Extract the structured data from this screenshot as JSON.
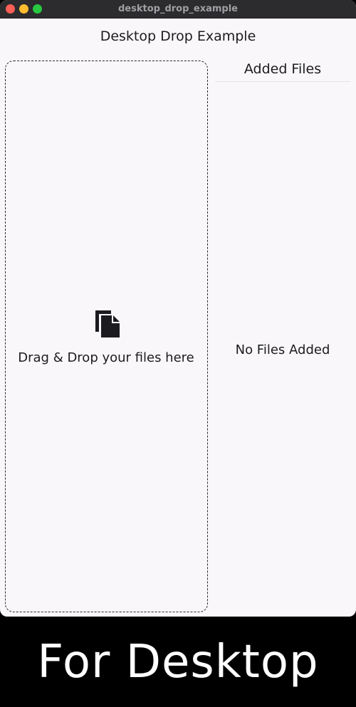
{
  "window": {
    "title": "desktop_drop_example",
    "controls": [
      "close",
      "minimize",
      "maximize"
    ]
  },
  "app": {
    "title": "Desktop Drop Example"
  },
  "drop_zone": {
    "icon": "file-copy-icon",
    "label": "Drag & Drop your files here"
  },
  "files_panel": {
    "header": "Added Files",
    "empty_label": "No Files Added"
  },
  "caption": {
    "text": "For Desktop"
  },
  "colors": {
    "window_background": "#f9f7f9",
    "titlebar": "#2c2b2e",
    "close": "#fe5f57",
    "minimize": "#febc2e",
    "maximize": "#28c840",
    "text": "#1c1b1f",
    "caption_background": "#000000",
    "caption_text": "#ffffff"
  }
}
